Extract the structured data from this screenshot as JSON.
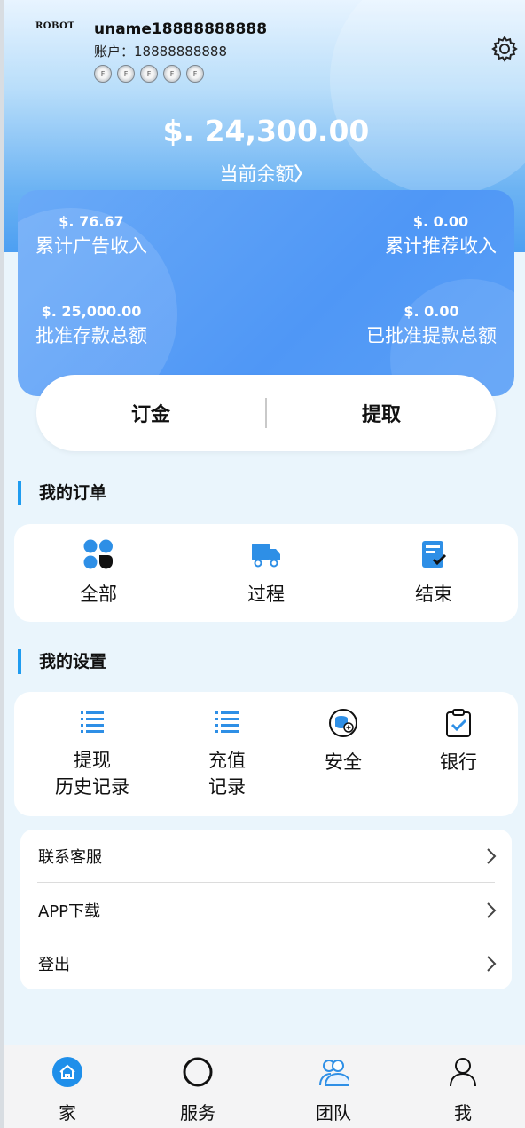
{
  "profile": {
    "logo_text": "ROBOT",
    "username": "uname18888888888",
    "account_label": "账户：",
    "account_value": "18888888888",
    "badges": [
      "F",
      "F",
      "F",
      "F",
      "F"
    ]
  },
  "balance": {
    "amount": "$. 24,300.00",
    "label": "当前余额",
    "chevron": "〉"
  },
  "stats": [
    {
      "value": "$. 76.67",
      "label": "累计广告收入"
    },
    {
      "value": "$. 0.00",
      "label": "累计推荐收入"
    },
    {
      "value": "$. 25,000.00",
      "label": "批准存款总额"
    },
    {
      "value": "$. 0.00",
      "label": "已批准提款总额"
    }
  ],
  "actions": {
    "deposit": "订金",
    "withdraw": "提取"
  },
  "orders": {
    "title": "我的订单",
    "items": [
      {
        "label": "全部",
        "icon": "grid-icon"
      },
      {
        "label": "过程",
        "icon": "truck-icon"
      },
      {
        "label": "结束",
        "icon": "clipboard-check-icon"
      }
    ]
  },
  "settings": {
    "title": "我的设置",
    "items": [
      {
        "line1": "提现",
        "line2": "历史记录",
        "icon": "list-icon"
      },
      {
        "line1": "充值",
        "line2": "记录",
        "icon": "list-icon"
      },
      {
        "line1": "安全",
        "line2": "",
        "icon": "coin-plus-icon"
      },
      {
        "line1": "银行",
        "line2": "",
        "icon": "clipboard-check-icon"
      }
    ]
  },
  "menu": [
    {
      "label": "联系客服"
    },
    {
      "label": "APP下载"
    },
    {
      "label": "登出"
    }
  ],
  "tabs": [
    {
      "label": "家",
      "icon": "home-icon"
    },
    {
      "label": "服务",
      "icon": "circle-icon"
    },
    {
      "label": "团队",
      "icon": "team-icon"
    },
    {
      "label": "我",
      "icon": "user-icon"
    }
  ],
  "colors": {
    "accent": "#1f9cf0",
    "card_blue": "#4f97f6",
    "icon_blue": "#2e8fe6"
  }
}
